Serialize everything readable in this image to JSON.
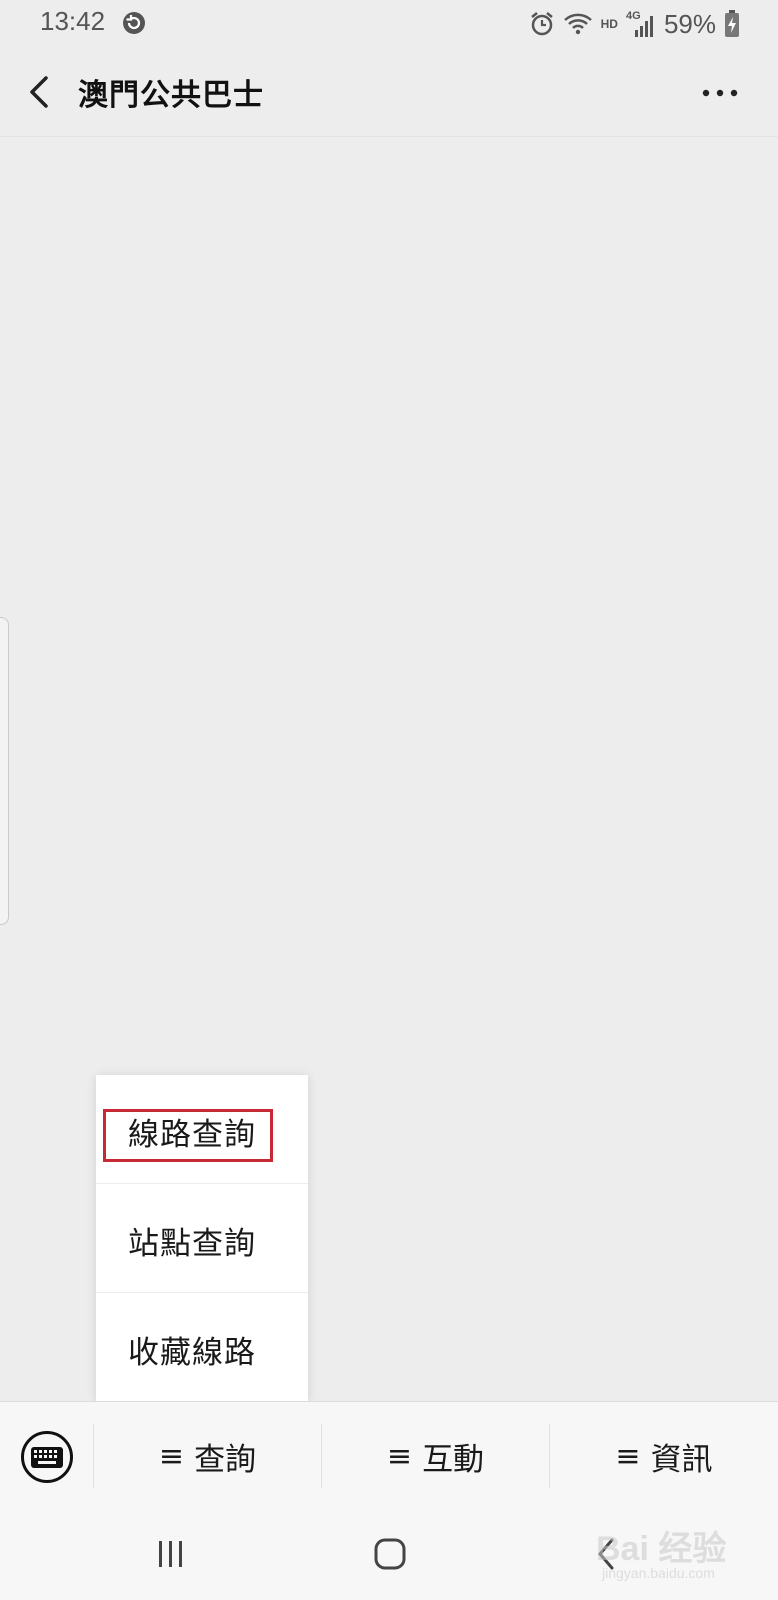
{
  "status_bar": {
    "time": "13:42",
    "network_label": "HD",
    "network_type": "4G",
    "battery": "59%",
    "icons": [
      "sync-icon",
      "alarm-icon",
      "wifi-icon",
      "signal-icon",
      "battery-icon"
    ]
  },
  "header": {
    "title": "澳門公共巴士",
    "back_icon": "chevron-left-icon",
    "more_icon": "more-dots-icon"
  },
  "popup_menu": {
    "items": [
      {
        "label": "線路查詢",
        "highlighted": true
      },
      {
        "label": "站點查詢",
        "highlighted": false
      },
      {
        "label": "收藏線路",
        "highlighted": false
      }
    ],
    "highlight_color": "#c72a34"
  },
  "bottom_menu": {
    "keyboard_icon": "keyboard-icon",
    "tabs": [
      {
        "label": "查詢",
        "icon": "≡"
      },
      {
        "label": "互動",
        "icon": "≡"
      },
      {
        "label": "資訊",
        "icon": "≡"
      }
    ]
  },
  "nav_bar": {
    "icons": [
      "recents-icon",
      "home-icon",
      "back-icon"
    ]
  },
  "watermark": {
    "main": "Bai 经验",
    "sub": "jingyan.baidu.com"
  }
}
